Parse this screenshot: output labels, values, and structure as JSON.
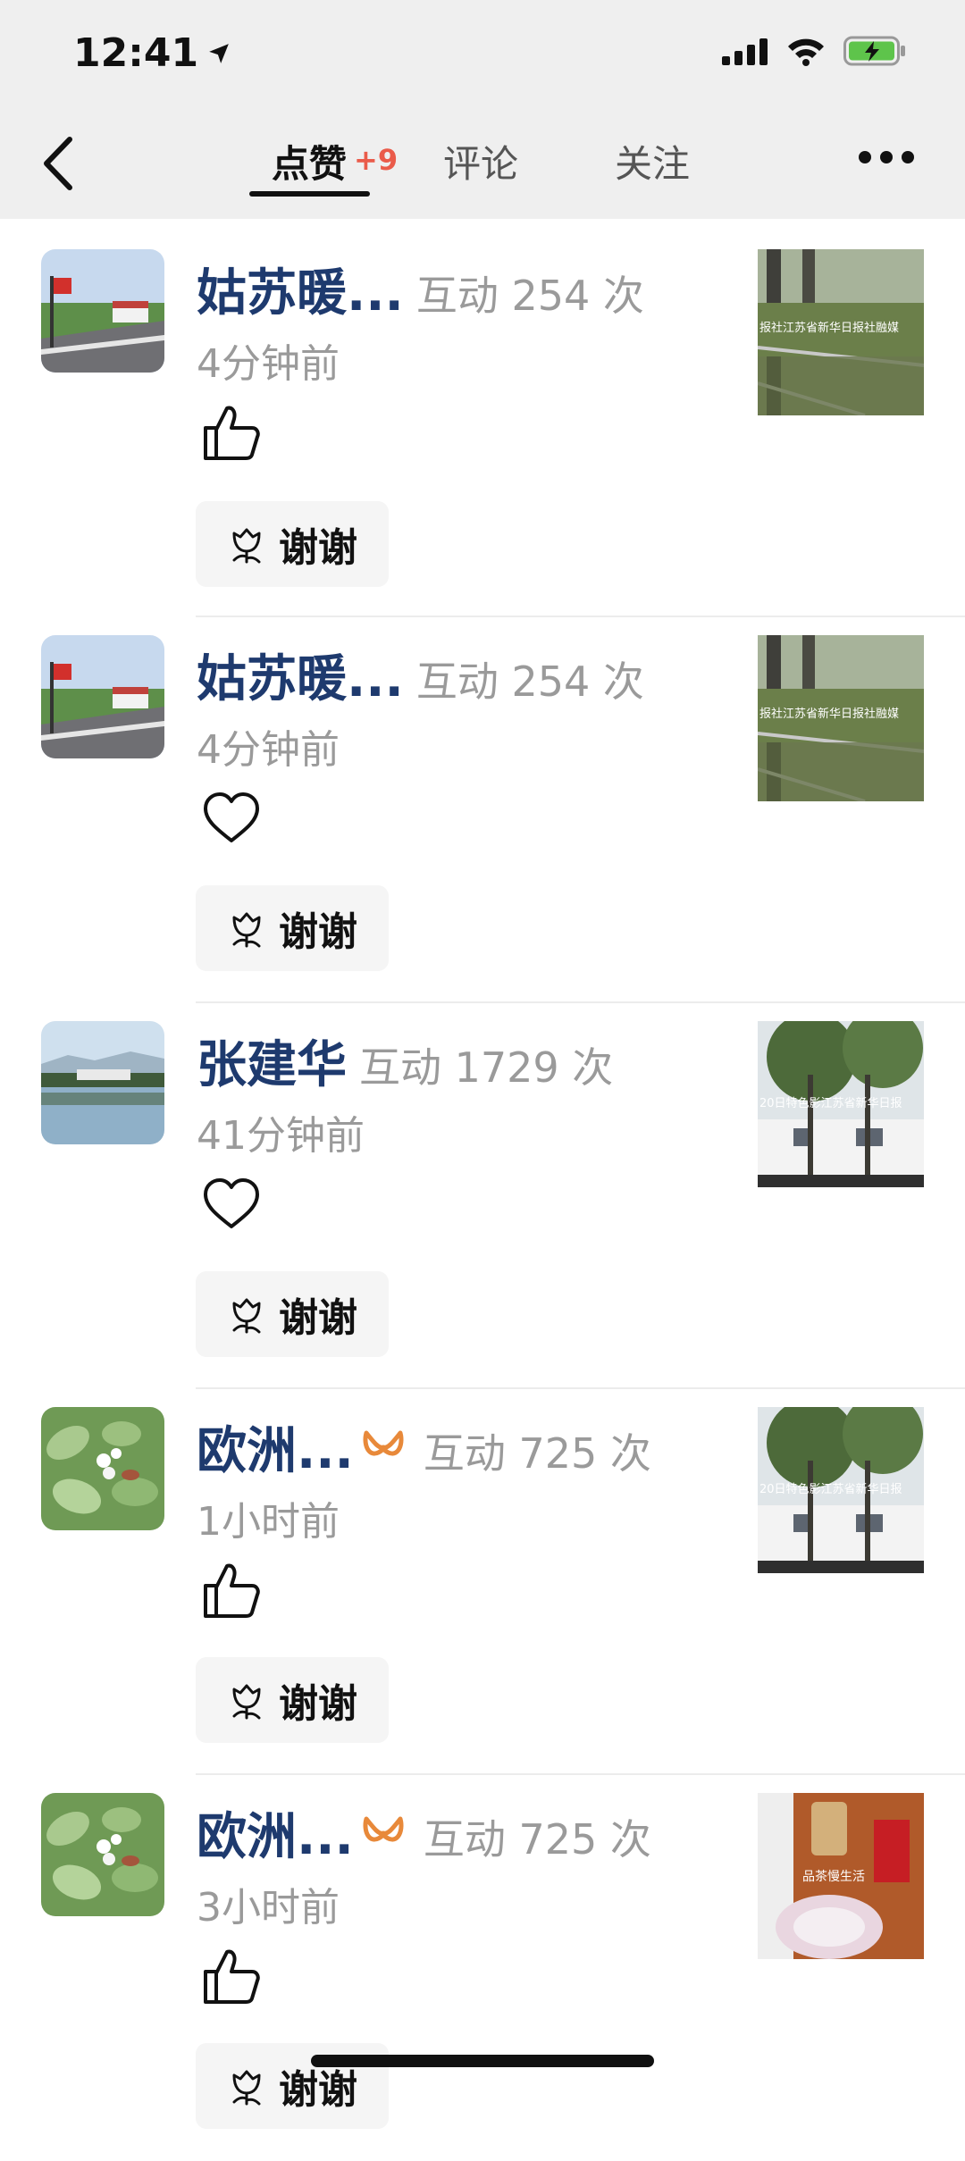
{
  "status": {
    "time": "12:41"
  },
  "nav": {
    "tabs": [
      {
        "label": "点赞",
        "badge": "+9"
      },
      {
        "label": "评论"
      },
      {
        "label": "关注"
      }
    ]
  },
  "items": [
    {
      "name": "姑苏暖...",
      "interaction": "互动 254 次",
      "time": "4分钟前",
      "reaction": "like",
      "thanks": "谢谢",
      "thumb_caption": "报社江苏省新华日报社融媒"
    },
    {
      "name": "姑苏暖...",
      "interaction": "互动 254 次",
      "time": "4分钟前",
      "reaction": "heart",
      "thanks": "谢谢",
      "thumb_caption": "报社江苏省新华日报社融媒"
    },
    {
      "name": "张建华",
      "interaction": "互动 1729 次",
      "time": "41分钟前",
      "reaction": "heart",
      "thanks": "谢谢",
      "thumb_caption": "20日特色影江苏省新华日报"
    },
    {
      "name": "欧洲...",
      "interaction": "互动 725 次",
      "time": "1小时前",
      "reaction": "like",
      "thanks": "谢谢",
      "thumb_caption": "20日特色影江苏省新华日报"
    },
    {
      "name": "欧洲...",
      "interaction": "互动 725 次",
      "time": "3小时前",
      "reaction": "like",
      "thanks": "谢谢",
      "thumb_caption": "品茶慢生活"
    }
  ],
  "colors": {
    "name": "#1e3a6e",
    "badge": "#ea5b4a",
    "vip": "#e8893a"
  }
}
